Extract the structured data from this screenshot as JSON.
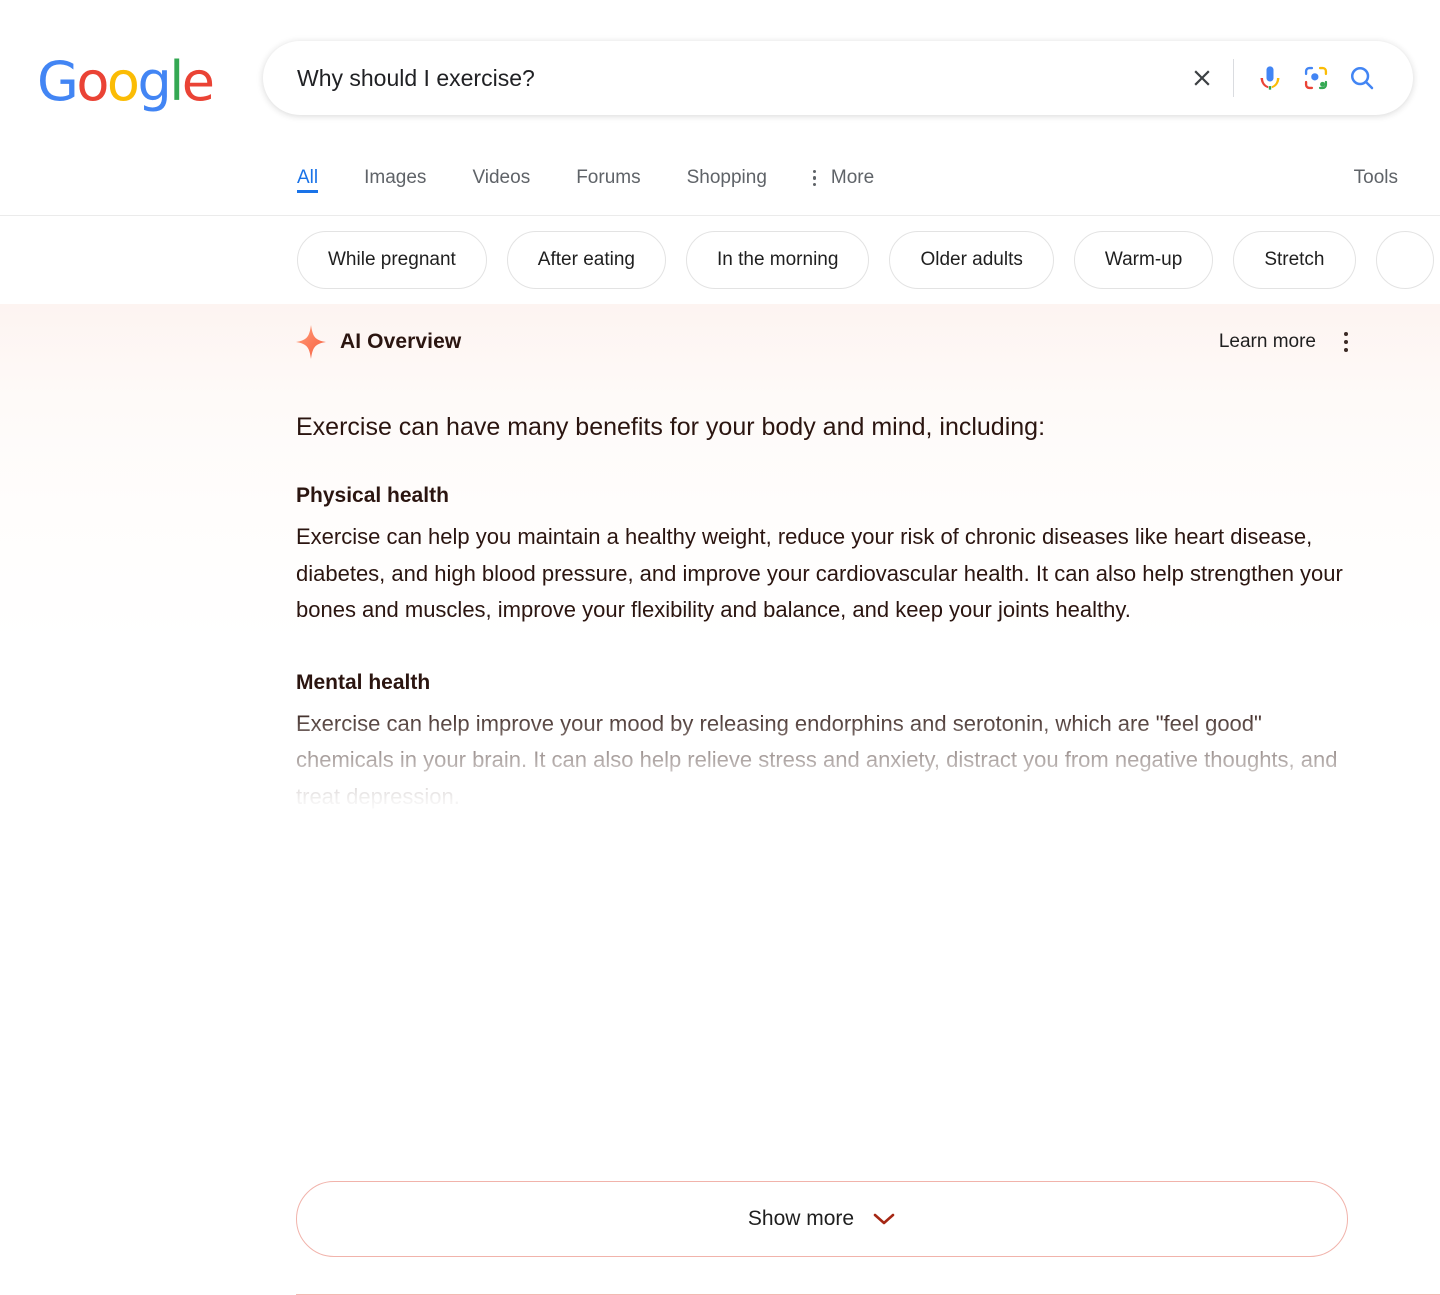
{
  "brand": {
    "logo_text": "Google",
    "logo_letters": [
      {
        "char": "G",
        "color": "#4285f4"
      },
      {
        "char": "o",
        "color": "#ea4335"
      },
      {
        "char": "o",
        "color": "#fbbc05"
      },
      {
        "char": "g",
        "color": "#4285f4"
      },
      {
        "char": "l",
        "color": "#34a853"
      },
      {
        "char": "e",
        "color": "#ea4335"
      }
    ]
  },
  "search": {
    "query": "Why should I exercise?",
    "placeholder": "Search",
    "clear_icon": "close-icon",
    "voice_icon": "microphone-icon",
    "lens_icon": "google-lens-icon",
    "submit_icon": "search-icon"
  },
  "nav": {
    "tabs": [
      {
        "label": "All",
        "active": true
      },
      {
        "label": "Images",
        "active": false
      },
      {
        "label": "Videos",
        "active": false
      },
      {
        "label": "Forums",
        "active": false
      },
      {
        "label": "Shopping",
        "active": false
      }
    ],
    "more_label": "More",
    "more_icon": "dots-vertical-icon",
    "tools_label": "Tools",
    "active_color": "#1a73e8"
  },
  "chips": [
    {
      "label": "While pregnant"
    },
    {
      "label": "After eating"
    },
    {
      "label": "In the morning"
    },
    {
      "label": "Older adults"
    },
    {
      "label": "Warm-up"
    },
    {
      "label": "Stretch"
    },
    {
      "label": ""
    }
  ],
  "ai_overview": {
    "icon": "sparkle-icon",
    "title": "AI Overview",
    "learn_more_label": "Learn more",
    "kebab_icon": "dots-vertical-icon",
    "intro": "Exercise can have many benefits for your body and mind, including:",
    "sections": [
      {
        "heading": "Physical health",
        "body": "Exercise can help you maintain a healthy weight, reduce your risk of chronic diseases like heart disease, diabetes, and high blood pressure, and improve your cardiovascular health. It can also help strengthen your bones and muscles, improve your flexibility and balance, and keep your joints healthy."
      },
      {
        "heading": "Mental health",
        "body": "Exercise can help improve your mood by releasing endorphins and serotonin, which are \"feel good\" chemicals in your brain. It can also help relieve stress and anxiety, distract you from negative thoughts, and treat depression."
      }
    ],
    "show_more_label": "Show more",
    "show_more_icon": "chevron-down-icon",
    "accent_color": "#d93025",
    "border_color": "#f1b3ab",
    "text_color": "#2b1510"
  }
}
